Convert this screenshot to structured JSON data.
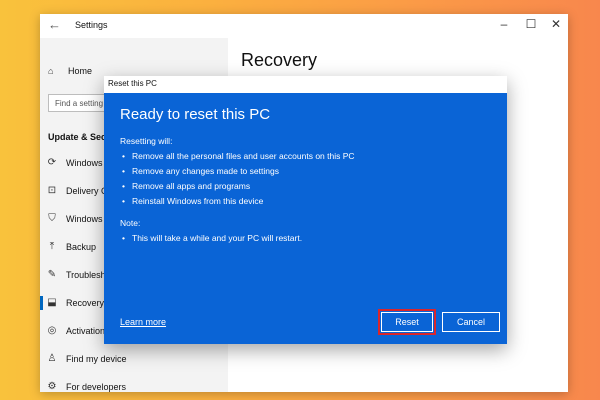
{
  "settings": {
    "title": "Settings",
    "home": "Home",
    "search_placeholder": "Find a setting",
    "section": "Update & Security",
    "nav": [
      {
        "label": "Windows Update",
        "icon": "refresh-icon"
      },
      {
        "label": "Delivery Optimization",
        "icon": "delivery-icon"
      },
      {
        "label": "Windows Security",
        "icon": "shield-icon"
      },
      {
        "label": "Backup",
        "icon": "backup-icon"
      },
      {
        "label": "Troubleshoot",
        "icon": "wrench-icon"
      },
      {
        "label": "Recovery",
        "icon": "recovery-icon",
        "active": true
      },
      {
        "label": "Activation",
        "icon": "check-circle-icon"
      },
      {
        "label": "Find my device",
        "icon": "person-pin-icon"
      },
      {
        "label": "For developers",
        "icon": "developer-icon"
      }
    ],
    "page_title": "Recovery"
  },
  "dialog": {
    "title": "Reset this PC",
    "heading": "Ready to reset this PC",
    "resetting_label": "Resetting will:",
    "resetting_items": [
      "Remove all the personal files and user accounts on this PC",
      "Remove any changes made to settings",
      "Remove all apps and programs",
      "Reinstall Windows from this device"
    ],
    "note_label": "Note:",
    "note_items": [
      "This will take a while and your PC will restart."
    ],
    "learn_more": "Learn more",
    "reset_button": "Reset",
    "cancel_button": "Cancel"
  },
  "colors": {
    "dialog_blue": "#0a64d6",
    "highlight_red": "#d9262c",
    "accent": "#0067c0"
  }
}
